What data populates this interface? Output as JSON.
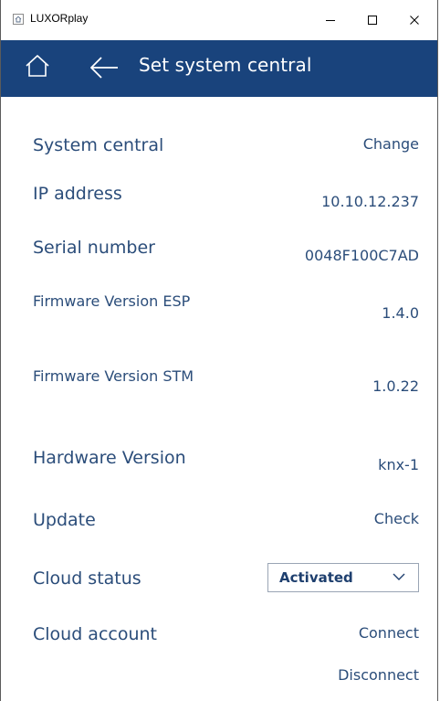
{
  "window": {
    "title": "LUXORplay"
  },
  "header": {
    "title": "Set system central"
  },
  "rows": {
    "system_central": {
      "label": "System central",
      "value": "Change"
    },
    "ip_address": {
      "label": "IP address",
      "value": "10.10.12.237"
    },
    "serial_number": {
      "label": "Serial number",
      "value": "0048F100C7AD"
    },
    "firmware_esp": {
      "label": "Firmware Version ESP",
      "value": "1.4.0"
    },
    "firmware_stm": {
      "label": "Firmware Version STM",
      "value": "1.0.22"
    },
    "hardware_version": {
      "label": "Hardware Version",
      "value": "knx-1"
    },
    "update": {
      "label": "Update",
      "value": "Check"
    },
    "cloud_status": {
      "label": "Cloud status",
      "selected": "Activated"
    },
    "cloud_account": {
      "label": "Cloud account",
      "connect": "Connect",
      "disconnect": "Disconnect"
    }
  },
  "colors": {
    "header_bg": "#19437c",
    "text": "#2b4d7a"
  },
  "icons": {
    "app": "house-icon",
    "home": "home-icon",
    "back": "arrow-left-icon",
    "minimize": "minimize-icon",
    "maximize": "maximize-icon",
    "close": "close-icon",
    "dropdown": "chevron-down-icon"
  }
}
